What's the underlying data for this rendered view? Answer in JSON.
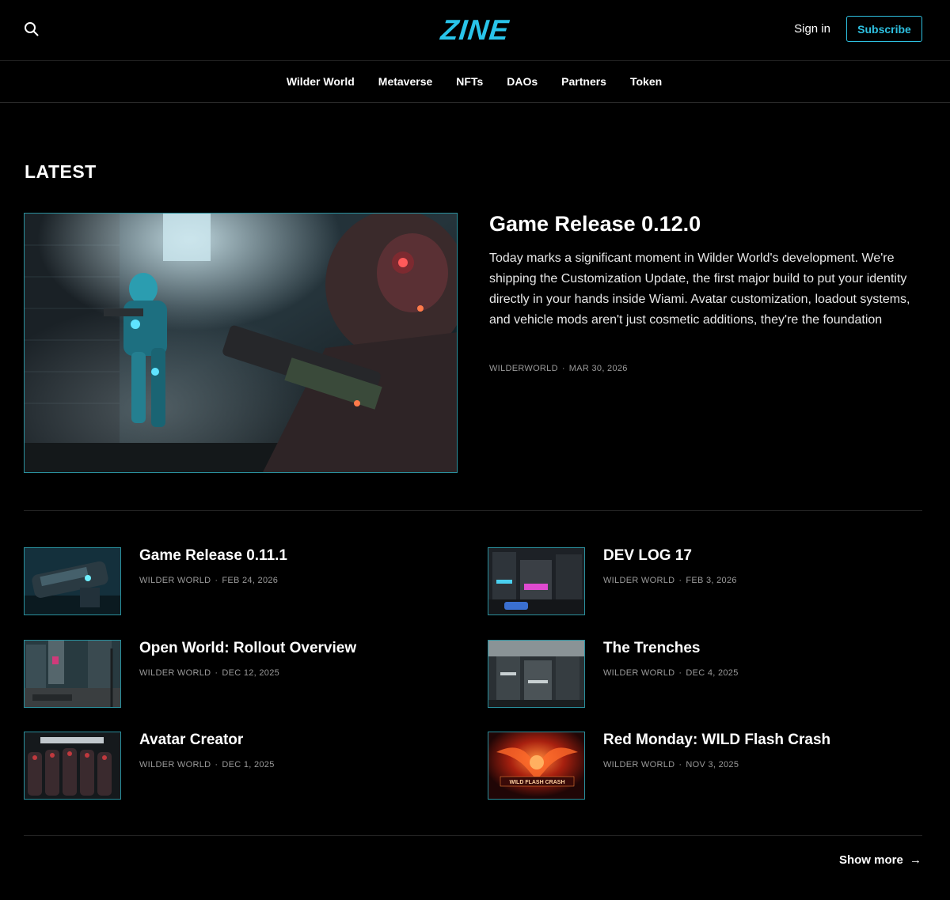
{
  "header": {
    "logo": "ZINE",
    "sign_in": "Sign in",
    "subscribe": "Subscribe"
  },
  "nav": {
    "items": [
      "Wilder World",
      "Metaverse",
      "NFTs",
      "DAOs",
      "Partners",
      "Token"
    ]
  },
  "section_title": "LATEST",
  "hero": {
    "title": "Game Release 0.12.0",
    "excerpt": "Today marks a significant moment in Wilder World's development. We're shipping the Customization Update, the first major build to put your identity directly in your hands inside Wiami. Avatar customization, loadout systems, and vehicle mods aren't just cosmetic additions, they're the foundation",
    "author": "WILDERWORLD",
    "date": "MAR 30, 2026"
  },
  "posts": [
    {
      "title": "Game Release 0.11.1",
      "author": "WILDER WORLD",
      "date": "FEB 24, 2026"
    },
    {
      "title": "DEV LOG 17",
      "author": "WILDER WORLD",
      "date": "FEB 3, 2026"
    },
    {
      "title": "Open World: Rollout Overview",
      "author": "WILDER WORLD",
      "date": "DEC 12, 2025"
    },
    {
      "title": "The Trenches",
      "author": "WILDER WORLD",
      "date": "DEC 4, 2025"
    },
    {
      "title": "Avatar Creator",
      "author": "WILDER WORLD",
      "date": "DEC 1, 2025"
    },
    {
      "title": "Red Monday: WILD Flash Crash",
      "author": "WILDER WORLD",
      "date": "NOV 3, 2025",
      "thumb_text": "WILD FLASH CRASH"
    }
  ],
  "show_more": "Show more",
  "colors": {
    "accent": "#29c4ea",
    "border": "#2a8f9c",
    "background": "#000000"
  }
}
